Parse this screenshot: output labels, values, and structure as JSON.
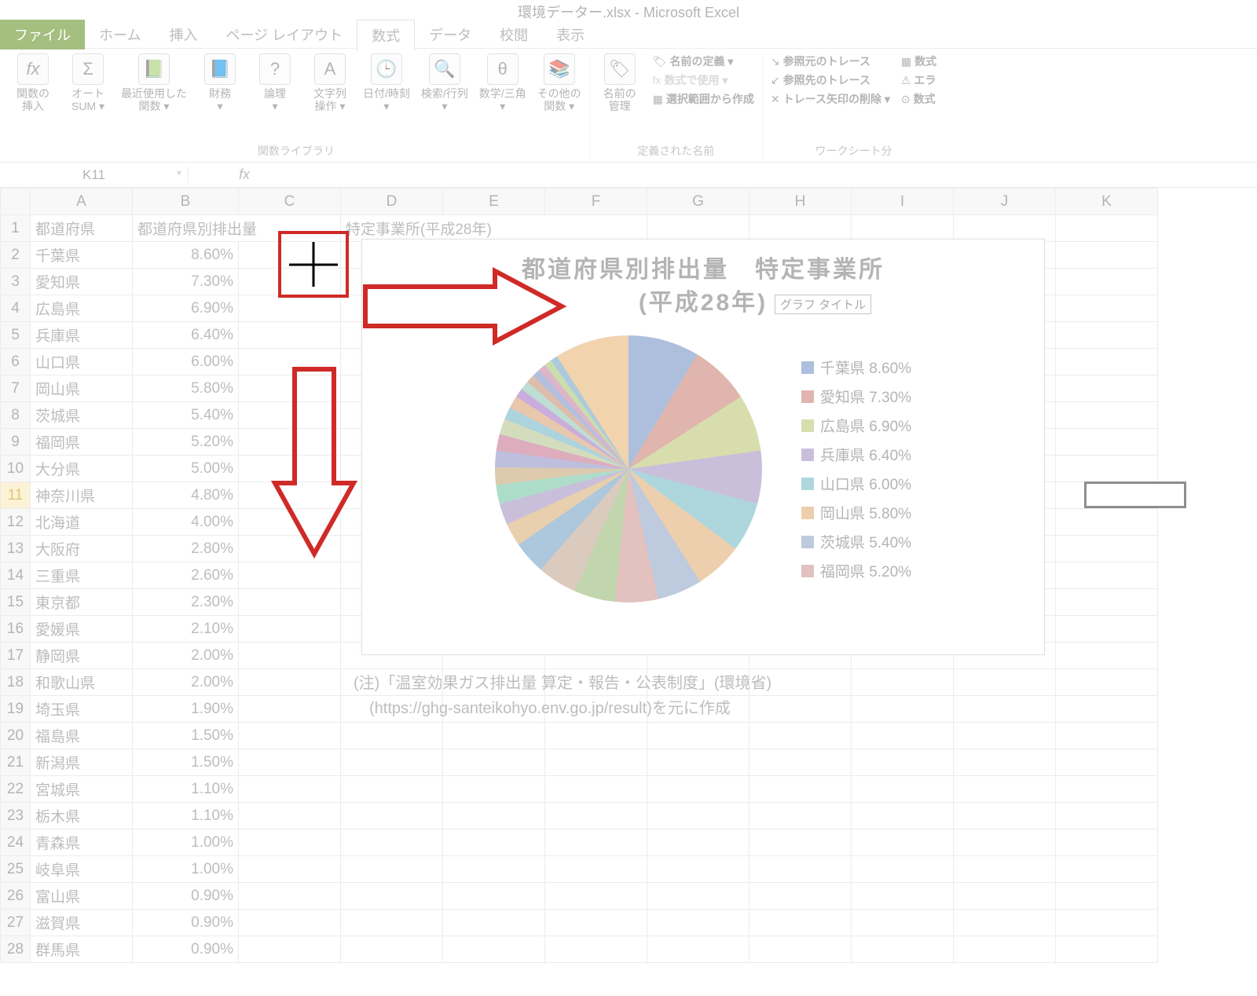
{
  "app": {
    "title": "環境データー.xlsx - Microsoft Excel"
  },
  "tabs": {
    "file": "ファイル",
    "items": [
      "ホーム",
      "挿入",
      "ページ レイアウト",
      "数式",
      "データ",
      "校閲",
      "表示"
    ],
    "active": "数式"
  },
  "ribbon": {
    "group1": {
      "fx_label": "関数の\n挿入",
      "autosum": "オート\nSUM ▾",
      "recent": "最近使用した\n関数 ▾",
      "financial": "財務\n▾",
      "logical": "論理\n▾",
      "text": "文字列\n操作 ▾",
      "datetime": "日付/時刻\n▾",
      "lookup": "検索/行列\n▾",
      "math": "数学/三角\n▾",
      "more": "その他の\n関数 ▾",
      "label": "関数ライブラリ"
    },
    "group2": {
      "namemgr": "名前の\n管理",
      "define": "名前の定義 ▾",
      "useinf": "数式で使用 ▾",
      "fromsel": "選択範囲から作成",
      "label": "定義された名前"
    },
    "group3": {
      "trace_prec": "参照元のトレース",
      "trace_dep": "参照先のトレース",
      "remove": "トレース矢印の削除 ▾",
      "showf": "数式",
      "err": "エラ",
      "eval": "数式",
      "label": "ワークシート分"
    }
  },
  "namebox": "K11",
  "columns": [
    "A",
    "B",
    "C",
    "D",
    "E",
    "F",
    "G",
    "H",
    "I",
    "J",
    "K"
  ],
  "headers": {
    "A": "都道府県",
    "B": "都道府県別排出量",
    "D": "特定事業所(平成28年)"
  },
  "rows": [
    {
      "n": 1
    },
    {
      "n": 2,
      "a": "千葉県",
      "b": "8.60%"
    },
    {
      "n": 3,
      "a": "愛知県",
      "b": "7.30%"
    },
    {
      "n": 4,
      "a": "広島県",
      "b": "6.90%"
    },
    {
      "n": 5,
      "a": "兵庫県",
      "b": "6.40%"
    },
    {
      "n": 6,
      "a": "山口県",
      "b": "6.00%"
    },
    {
      "n": 7,
      "a": "岡山県",
      "b": "5.80%"
    },
    {
      "n": 8,
      "a": "茨城県",
      "b": "5.40%"
    },
    {
      "n": 9,
      "a": "福岡県",
      "b": "5.20%"
    },
    {
      "n": 10,
      "a": "大分県",
      "b": "5.00%"
    },
    {
      "n": 11,
      "a": "神奈川県",
      "b": "4.80%"
    },
    {
      "n": 12,
      "a": "北海道",
      "b": "4.00%"
    },
    {
      "n": 13,
      "a": "大阪府",
      "b": "2.80%"
    },
    {
      "n": 14,
      "a": "三重県",
      "b": "2.60%"
    },
    {
      "n": 15,
      "a": "東京都",
      "b": "2.30%"
    },
    {
      "n": 16,
      "a": "愛媛県",
      "b": "2.10%"
    },
    {
      "n": 17,
      "a": "静岡県",
      "b": "2.00%"
    },
    {
      "n": 18,
      "a": "和歌山県",
      "b": "2.00%"
    },
    {
      "n": 19,
      "a": "埼玉県",
      "b": "1.90%"
    },
    {
      "n": 20,
      "a": "福島県",
      "b": "1.50%"
    },
    {
      "n": 21,
      "a": "新潟県",
      "b": "1.50%"
    },
    {
      "n": 22,
      "a": "宮城県",
      "b": "1.10%"
    },
    {
      "n": 23,
      "a": "栃木県",
      "b": "1.10%"
    },
    {
      "n": 24,
      "a": "青森県",
      "b": "1.00%"
    },
    {
      "n": 25,
      "a": "岐阜県",
      "b": "1.00%"
    },
    {
      "n": 26,
      "a": "富山県",
      "b": "0.90%"
    },
    {
      "n": 27,
      "a": "滋賀県",
      "b": "0.90%"
    },
    {
      "n": 28,
      "a": "群馬県",
      "b": "0.90%"
    }
  ],
  "chart": {
    "title_l1": "都道府県別排出量　特定事業所",
    "title_l2": "(平成28年)",
    "tooltip": "グラフ タイトル",
    "legend": [
      {
        "c": "#6b8bc3",
        "t": "千葉県 8.60%"
      },
      {
        "c": "#c87a6b",
        "t": "愛知県 7.30%"
      },
      {
        "c": "#b9c36b",
        "t": "広島県 6.90%"
      },
      {
        "c": "#a08bbf",
        "t": "兵庫県 6.40%"
      },
      {
        "c": "#6bb7c3",
        "t": "山口県 6.00%"
      },
      {
        "c": "#e0a96b",
        "t": "岡山県 5.80%"
      },
      {
        "c": "#8aa0c3",
        "t": "茨城県 5.40%"
      },
      {
        "c": "#cc8f8a",
        "t": "福岡県 5.20%"
      }
    ]
  },
  "footnote": {
    "l1": "(注)「温室効果ガス排出量 算定・報告・公表制度」(環境省)",
    "l2": "　(https://ghg-santeikohyo.env.go.jp/result)を元に作成"
  },
  "chart_data": {
    "type": "pie",
    "title": "都道府県別排出量　特定事業所 (平成28年)",
    "categories": [
      "千葉県",
      "愛知県",
      "広島県",
      "兵庫県",
      "山口県",
      "岡山県",
      "茨城県",
      "福岡県",
      "大分県",
      "神奈川県",
      "北海道",
      "大阪府",
      "三重県",
      "東京都",
      "愛媛県",
      "静岡県",
      "和歌山県",
      "埼玉県",
      "福島県",
      "新潟県",
      "宮城県",
      "栃木県",
      "青森県",
      "岐阜県",
      "富山県",
      "滋賀県",
      "群馬県"
    ],
    "values": [
      8.6,
      7.3,
      6.9,
      6.4,
      6.0,
      5.8,
      5.4,
      5.2,
      5.0,
      4.8,
      4.0,
      2.8,
      2.6,
      2.3,
      2.1,
      2.0,
      2.0,
      1.9,
      1.5,
      1.5,
      1.1,
      1.1,
      1.0,
      1.0,
      0.9,
      0.9,
      0.9
    ],
    "unit": "%"
  }
}
